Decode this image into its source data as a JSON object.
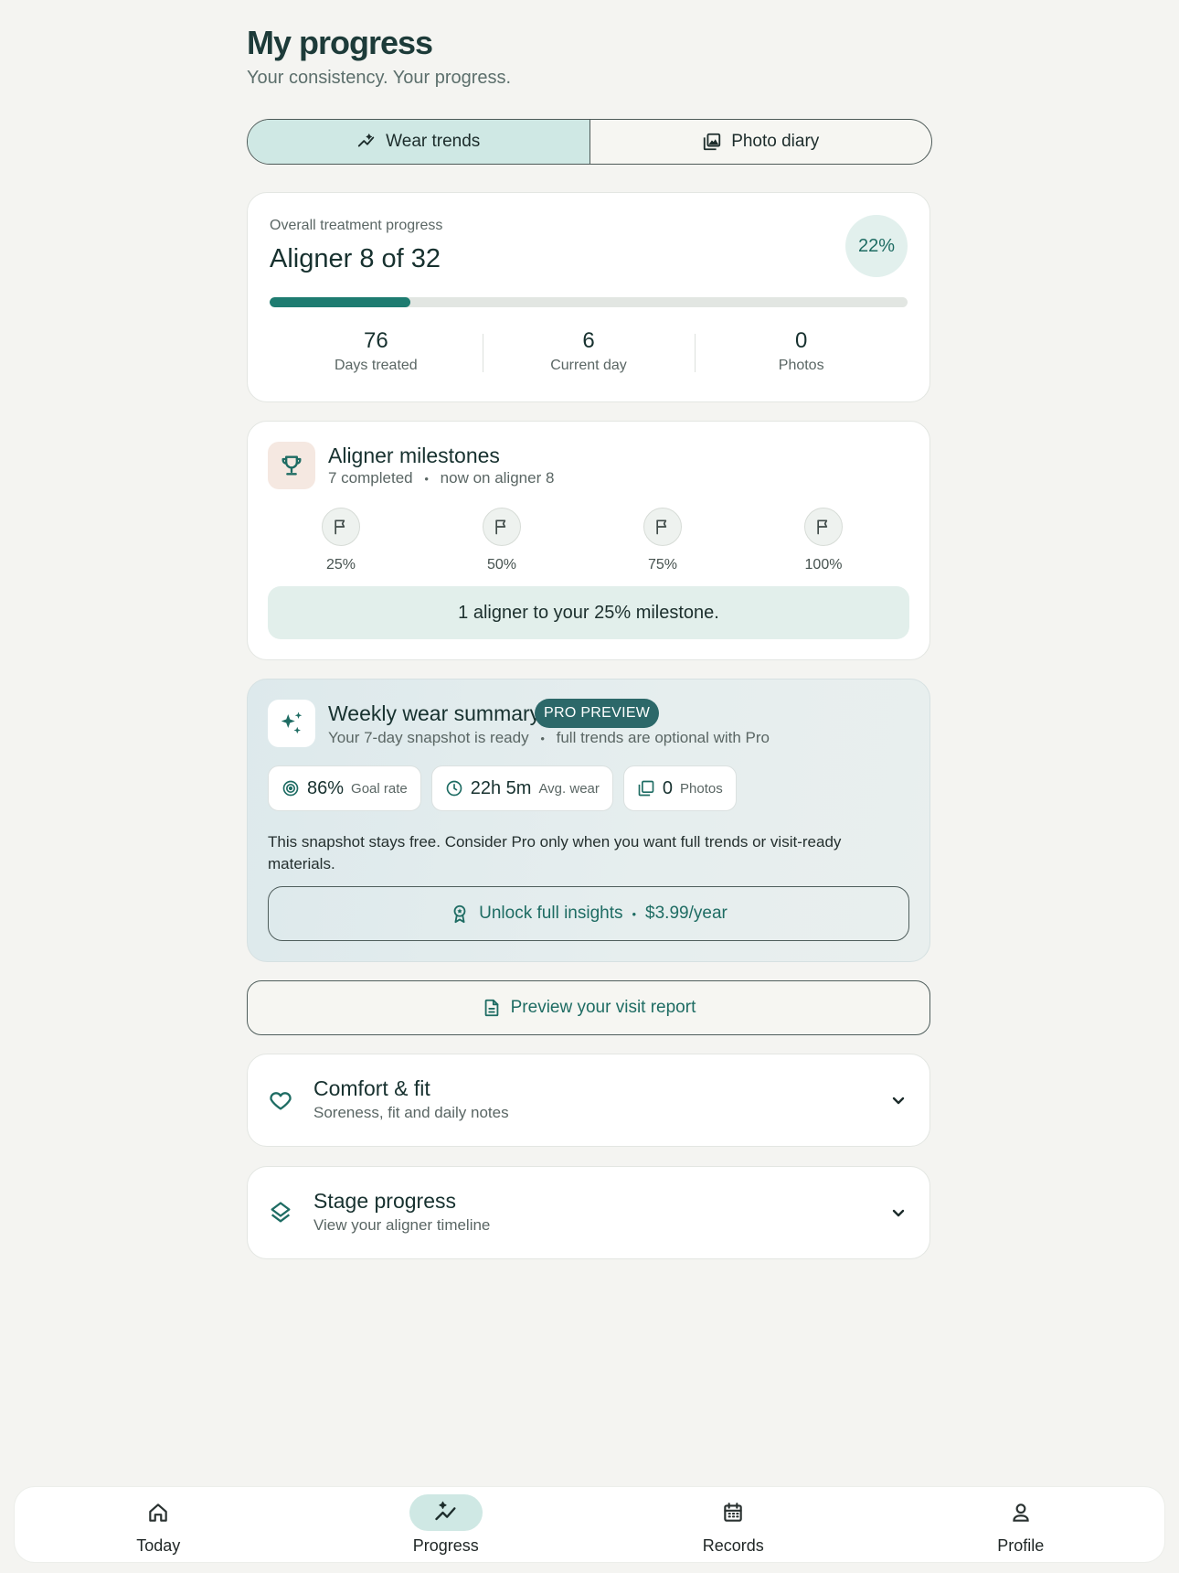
{
  "header": {
    "title": "My progress",
    "subtitle": "Your consistency. Your progress."
  },
  "tabs": [
    {
      "label": "Wear trends",
      "icon": "trend-icon",
      "active": true
    },
    {
      "label": "Photo diary",
      "icon": "photo-library-icon",
      "active": false
    }
  ],
  "progress": {
    "label": "Overall treatment progress",
    "title": "Aligner 8 of 32",
    "percent_text": "22%",
    "fill_fraction": 0.22,
    "stats": [
      {
        "value": "76",
        "label": "Days treated"
      },
      {
        "value": "6",
        "label": "Current day"
      },
      {
        "value": "0",
        "label": "Photos"
      }
    ]
  },
  "milestones": {
    "title": "Aligner milestones",
    "completed": "7 completed",
    "current": "now on aligner 8",
    "separator": "•",
    "flags": [
      "25%",
      "50%",
      "75%",
      "100%"
    ],
    "banner": "1 aligner to your 25% milestone."
  },
  "weekly": {
    "title": "Weekly wear summary",
    "badge": "PRO PREVIEW",
    "sub_a": "Your 7-day snapshot is ready",
    "sub_b": "full trends are optional with Pro",
    "separator": "•",
    "chips": [
      {
        "value": "86%",
        "label": "Goal rate",
        "icon": "target-icon"
      },
      {
        "value": "22h 5m",
        "label": "Avg. wear",
        "icon": "clock-icon"
      },
      {
        "value": "0",
        "label": "Photos",
        "icon": "photo-library-icon"
      }
    ],
    "note": "This snapshot stays free. Consider Pro only when you want full trends or visit-ready materials.",
    "unlock_label": "Unlock full insights",
    "unlock_price": "$3.99/year"
  },
  "visit_report": {
    "label": "Preview your visit report"
  },
  "accordions": [
    {
      "title": "Comfort & fit",
      "subtitle": "Soreness, fit and daily notes",
      "icon": "heart-icon"
    },
    {
      "title": "Stage progress",
      "subtitle": "View your aligner timeline",
      "icon": "layers-icon"
    }
  ],
  "bottom_nav": [
    {
      "label": "Today",
      "icon": "home-icon",
      "active": false
    },
    {
      "label": "Progress",
      "icon": "trend-icon",
      "active": true
    },
    {
      "label": "Records",
      "icon": "calendar-icon",
      "active": false
    },
    {
      "label": "Profile",
      "icon": "person-icon",
      "active": false
    }
  ],
  "colors": {
    "accent": "#1e7c71",
    "accent_soft": "#cfe8e4",
    "background": "#f4f4f1",
    "pro_badge": "#2c6869"
  }
}
